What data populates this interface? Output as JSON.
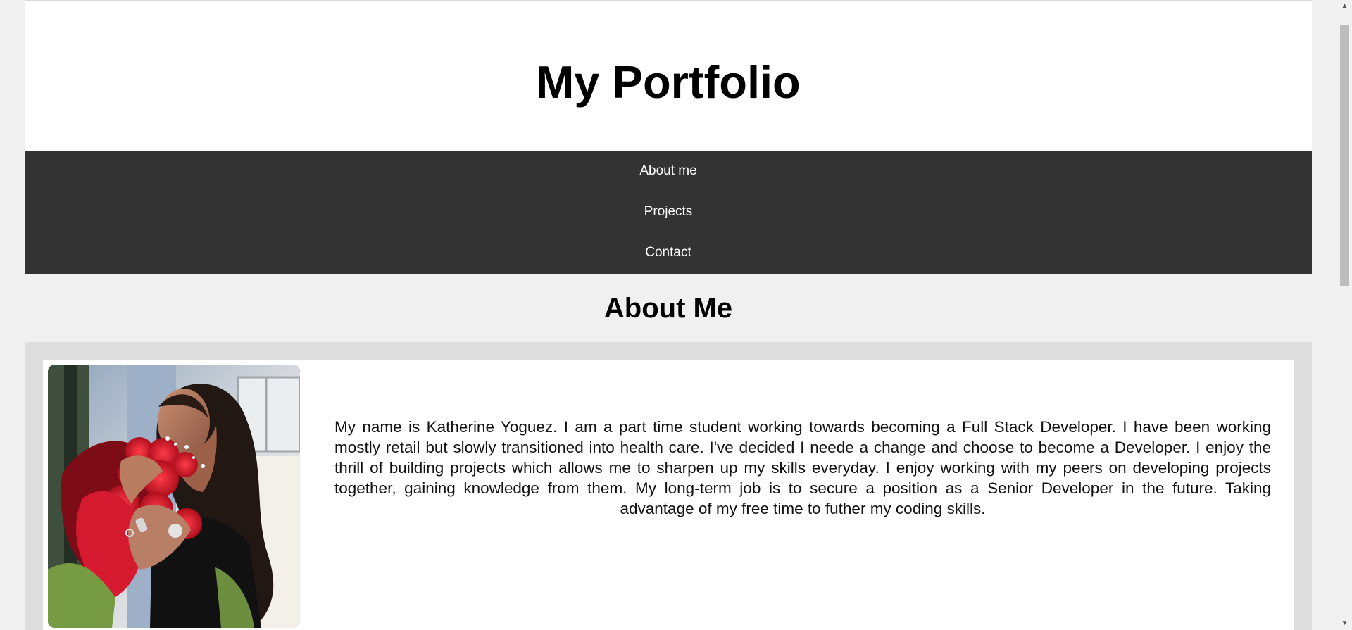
{
  "header": {
    "title": "My Portfolio"
  },
  "nav": {
    "items": [
      {
        "label": "About me"
      },
      {
        "label": "Projects"
      },
      {
        "label": "Contact"
      }
    ]
  },
  "about": {
    "heading": "About Me",
    "bio": "My name is Katherine Yoguez. I am a part time student working towards becoming a Full Stack Developer. I have been working mostly retail but slowly transitioned into health care. I've decided I neede a change and choose to become a Developer. I enjoy the thrill of building projects which allows me to sharpen up my skills everyday. I enjoy working with my peers on developing projects together, gaining knowledge from them. My long-term job is to secure a position as a Senior Developer in the future. Taking advantage of my free time to futher my coding skills."
  },
  "icons": {
    "scroll_up": "chevron-up-icon",
    "scroll_down": "chevron-down-icon"
  },
  "colors": {
    "page_background": "#f0f0f0",
    "header_background": "#ffffff",
    "nav_background": "#333333",
    "nav_text": "#ffffff",
    "about_band": "#dddddd",
    "card_background": "#ffffff"
  }
}
